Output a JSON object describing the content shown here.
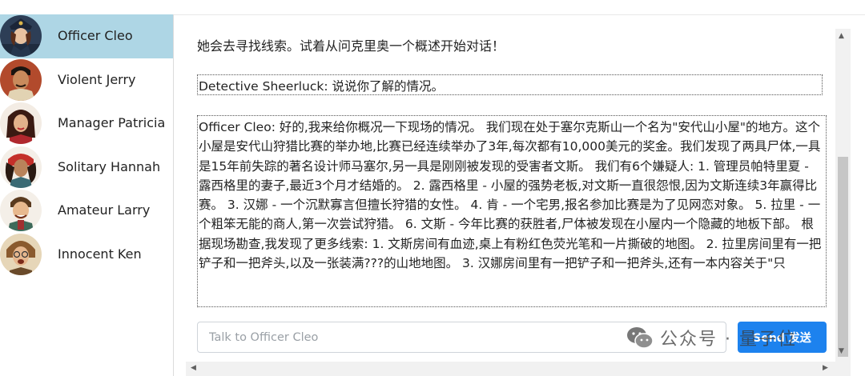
{
  "sidebar": {
    "items": [
      {
        "label": "Officer Cleo",
        "active": true
      },
      {
        "label": "Violent Jerry"
      },
      {
        "label": "Manager Patricia"
      },
      {
        "label": "Solitary Hannah"
      },
      {
        "label": "Amateur Larry"
      },
      {
        "label": "Innocent Ken"
      }
    ]
  },
  "chat": {
    "intro": "她会去寻找线索。试着从问克里奥一个概述开始对话！",
    "messages": [
      {
        "text": "Detective Sheerluck: 说说你了解的情况。"
      },
      {
        "text": "Officer Cleo: 好的,我来给你概况一下现场的情况。 我们现在处于塞尔克斯山一个名为\"安代山小屋\"的地方。这个小屋是安代山狩猎比赛的举办地,比赛已经连续举办了3年,每次都有10,000美元的奖金。我们发现了两具尸体,一具是15年前失踪的著名设计师马塞尔,另一具是刚刚被发现的受害者文斯。 我们有6个嫌疑人: 1. 管理员帕特里夏 - 露西格里的妻子,最近3个月才结婚的。 2. 露西格里 - 小屋的强势老板,对文斯一直很怨恨,因为文斯连续3年赢得比赛。 3. 汉娜 - 一个沉默寡言但擅长狩猎的女性。 4. 肯 - 一个宅男,报名参加比赛是为了见网恋对象。 5. 拉里 - 一个粗笨无能的商人,第一次尝试狩猎。 6. 文斯 - 今年比赛的获胜者,尸体被发现在小屋内一个隐藏的地板下部。 根据现场勘查,我发现了更多线索: 1. 文斯房间有血迹,桌上有粉红色荧光笔和一片撕破的地图。 2. 拉里房间里有一把铲子和一把斧头,以及一张装满???的山地地图。 3. 汉娜房间里有一把铲子和一把斧头,还有一本内容关于\"只"
      }
    ]
  },
  "input": {
    "placeholder": "Talk to Officer Cleo",
    "value": ""
  },
  "send_label": "Send 发送",
  "watermark": "公众号 · 量子位",
  "scroll": {
    "up": "▲",
    "down": "▼",
    "left": "◀",
    "right": "▶"
  }
}
